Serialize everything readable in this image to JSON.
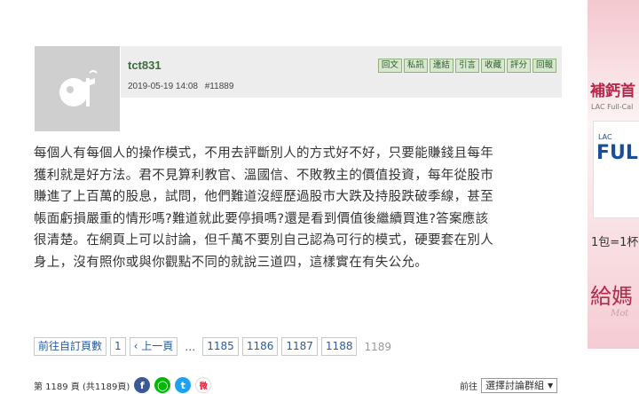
{
  "post": {
    "username": "tct831",
    "datetime": "2019-05-19 14:08",
    "post_number": "#11889",
    "actions": [
      "回文",
      "私訊",
      "連結",
      "引言",
      "收藏",
      "評分",
      "回報"
    ],
    "body_lines": [
      "每個人有每個人的操作模式，不用去評斷別人的方式好不好，只要能賺錢且每年",
      "獲利就是好方法。君不見算利教官、溫國信、不敗教主的價值投資，每年從股市",
      "賺進了上百萬的股息，試問，他們難道沒經歷過股市大跌及持股跌破季線，甚至",
      "帳面虧損嚴重的情形嗎?難道就此要停損嗎?還是看到價值後繼續買進?答案應該",
      "很清楚。在網頁上可以討論，但千萬不要別自己認為可行的模式，硬要套在別人",
      "身上，沒有照你或與你觀點不同的就說三道四，這樣實在有失公允。"
    ]
  },
  "pagination": {
    "custom_page_label": "前往自訂頁數",
    "first": "1",
    "prev_label": "‹ 上一頁",
    "ellipsis": "…",
    "pages": [
      "1185",
      "1186",
      "1187",
      "1188"
    ],
    "current": "1189"
  },
  "footer": {
    "page_info": "第 1189 頁 (共1189頁)",
    "share_icons": [
      {
        "name": "facebook-icon",
        "glyph": "f",
        "color": "#3b5998"
      },
      {
        "name": "line-icon",
        "glyph": "◯",
        "color": "#00b900"
      },
      {
        "name": "twitter-icon",
        "glyph": "t",
        "color": "#1da1f2"
      },
      {
        "name": "weibo-icon",
        "glyph": "微",
        "color": "#e6162d"
      }
    ],
    "goto_label": "前往",
    "forum_select": "選擇討論群組"
  },
  "ad": {
    "title": "補鈣首",
    "subtitle": "LAC Full-Cal",
    "brand": "LAC",
    "product": "FUL",
    "offer": "1包=1杯",
    "mom": "給媽",
    "script": "Mot"
  }
}
